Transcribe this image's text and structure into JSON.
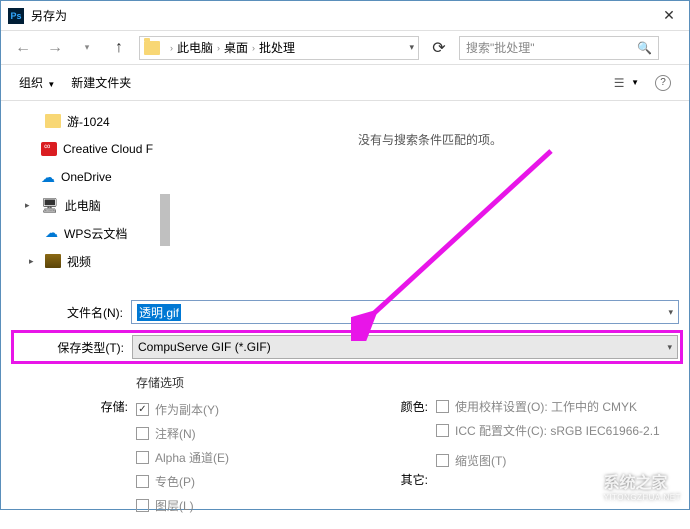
{
  "titlebar": {
    "icon_text": "Ps",
    "title": "另存为"
  },
  "nav": {
    "breadcrumb": [
      "此电脑",
      "桌面",
      "批处理"
    ],
    "search_placeholder": "搜索\"批处理\""
  },
  "toolbar": {
    "organize": "组织",
    "new_folder": "新建文件夹"
  },
  "sidebar": {
    "items": [
      {
        "label": "游-1024",
        "icon": "folder"
      },
      {
        "label": "Creative Cloud F",
        "icon": "cc"
      },
      {
        "label": "OneDrive",
        "icon": "cloud"
      },
      {
        "label": "此电脑",
        "icon": "pc",
        "expandable": true
      },
      {
        "label": "WPS云文档",
        "icon": "wps"
      },
      {
        "label": "视频",
        "icon": "video",
        "expandable": true
      }
    ]
  },
  "main": {
    "empty_msg": "没有与搜索条件匹配的项。"
  },
  "filename": {
    "label": "文件名(N):",
    "value": "透明.gif"
  },
  "filetype": {
    "label": "保存类型(T):",
    "value": "CompuServe GIF (*.GIF)"
  },
  "options": {
    "header": "存储选项",
    "store_label": "存储:",
    "store_items": [
      {
        "label": "作为副本(Y)",
        "checked": true
      },
      {
        "label": "注释(N)",
        "checked": false
      },
      {
        "label": "Alpha 通道(E)",
        "checked": false
      },
      {
        "label": "专色(P)",
        "checked": false
      },
      {
        "label": "图层(L)",
        "checked": false
      }
    ],
    "color_label": "颜色:",
    "color_items": [
      {
        "label": "使用校样设置(O): 工作中的 CMYK",
        "checked": false
      },
      {
        "label": "ICC 配置文件(C): sRGB IEC61966-2.1",
        "checked": false
      }
    ],
    "other_label": "其它:",
    "other_items": [
      {
        "label": "缩览图(T)",
        "checked": false
      }
    ]
  },
  "watermark": {
    "brand": "系统之家",
    "url": "YITONGZHUA.NET"
  }
}
